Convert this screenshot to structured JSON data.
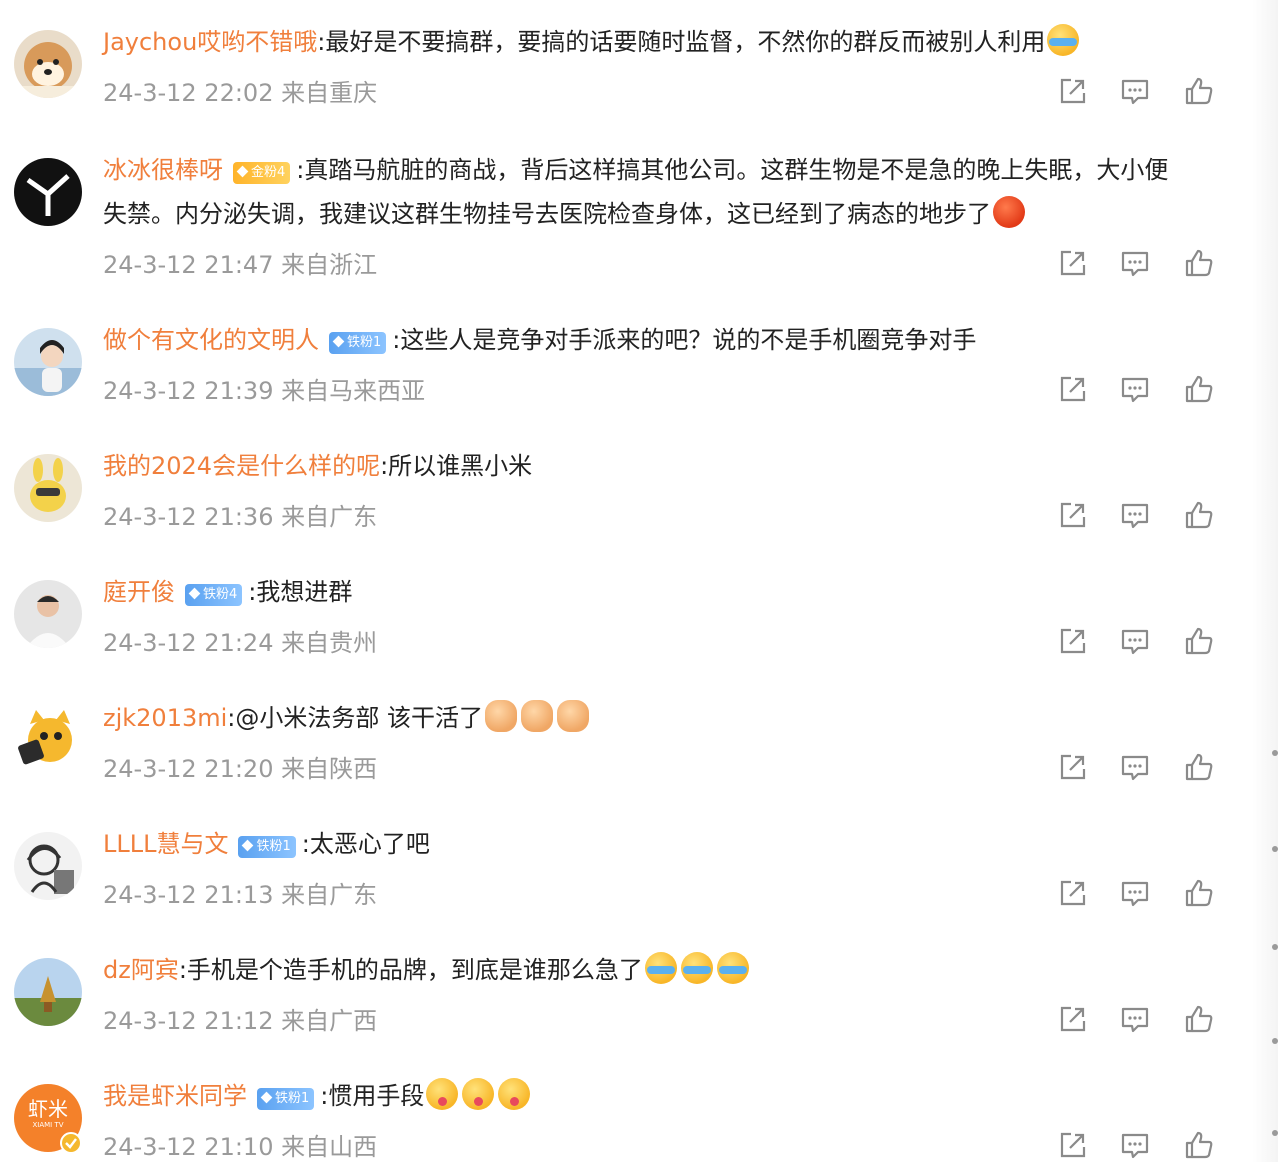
{
  "comments": [
    {
      "user": "Jaychou哎哟不错哦",
      "badge": "",
      "badge_type": "",
      "text": ":最好是不要搞群，要搞的话要随时监督，不然你的群反而被别人利用",
      "emojis": [
        "laugh-cry-emoji"
      ],
      "time": "24-3-12 22:02 来自重庆",
      "avatar": "shiba-dog-avatar"
    },
    {
      "user": "冰冰很棒呀",
      "badge": "金粉4",
      "badge_type": "gold",
      "text": ":真踏马航脏的商战，背后这样搞其他公司。这群生物是不是急的晚上失眠，大小便失禁。内分泌失调，我建议这群生物挂号去医院检查身体，这已经到了病态的地步了",
      "emojis": [
        "angry-emoji"
      ],
      "time": "24-3-12 21:47 来自浙江",
      "avatar": "dark-logo-avatar"
    },
    {
      "user": "做个有文化的文明人",
      "badge": "铁粉1",
      "badge_type": "iron",
      "text": ":这些人是竞争对手派来的吧？说的不是手机圈竞争对手",
      "emojis": [],
      "time": "24-3-12 21:39 来自马来西亚",
      "avatar": "girl-photo-avatar"
    },
    {
      "user": "我的2024会是什么样的呢",
      "badge": "",
      "badge_type": "",
      "text": ":所以谁黑小米",
      "emojis": [],
      "time": "24-3-12 21:36 来自广东",
      "avatar": "plush-toy-avatar"
    },
    {
      "user": "庭开俊",
      "badge": "铁粉4",
      "badge_type": "iron",
      "text": ":我想进群",
      "emojis": [],
      "time": "24-3-12 21:24 来自贵州",
      "avatar": "man-photo-avatar"
    },
    {
      "user": "zjk2013mi",
      "badge": "",
      "badge_type": "",
      "text": ":@小米法务部 该干活了",
      "emojis": [
        "fist-emoji",
        "fist-emoji",
        "fist-emoji"
      ],
      "time": "24-3-12 21:20 来自陕西",
      "avatar": "cartoon-cat-avatar"
    },
    {
      "user": "LLLL慧与文",
      "badge": "铁粉1",
      "badge_type": "iron",
      "text": ":太恶心了吧",
      "emojis": [],
      "time": "24-3-12 21:13 来自广东",
      "avatar": "sketch-avatar"
    },
    {
      "user": "dz阿宾",
      "badge": "",
      "badge_type": "",
      "text": ":手机是个造手机的品牌，到底是谁那么急了",
      "emojis": [
        "laugh-cry-emoji",
        "laugh-cry-emoji",
        "laugh-cry-emoji"
      ],
      "time": "24-3-12 21:12 来自广西",
      "avatar": "landscape-avatar"
    },
    {
      "user": "我是虾米同学",
      "badge": "铁粉1",
      "badge_type": "iron",
      "text": ":惯用手段",
      "emojis": [
        "yum-emoji",
        "yum-emoji",
        "yum-emoji"
      ],
      "time": "24-3-12 21:10 来自山西",
      "avatar": "xiami-orange-avatar",
      "avatar_text": "虾米",
      "avatar_subtext": "XIAMI TV"
    }
  ],
  "action_icons": [
    "share-icon",
    "comment-icon",
    "like-icon"
  ],
  "colors": {
    "username": "#f07f3c",
    "meta": "#9a9a9a",
    "text": "#222222",
    "gold_badge": "#ffb42a",
    "iron_badge": "#5aa1f0",
    "icon": "#8a8a8a"
  }
}
